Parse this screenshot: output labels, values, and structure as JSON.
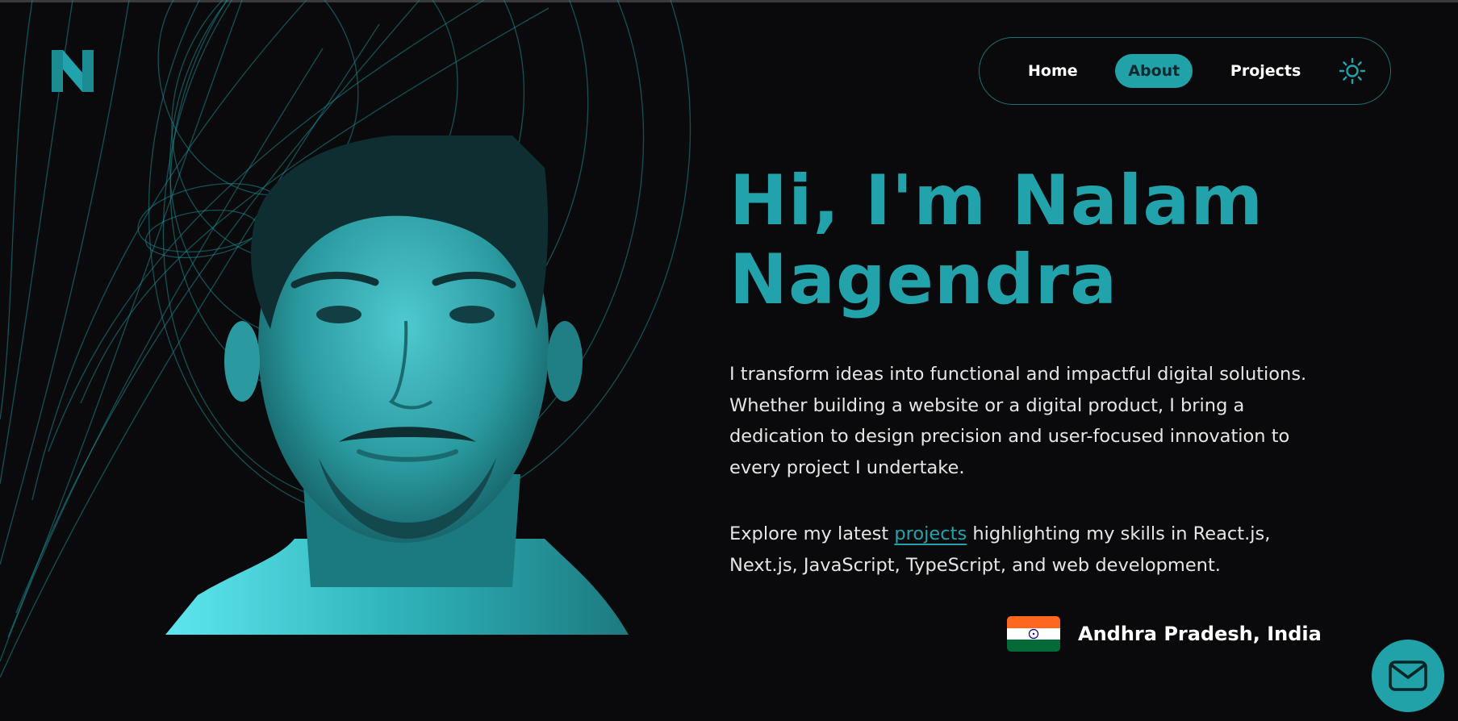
{
  "nav": {
    "items": [
      {
        "label": "Home",
        "active": false
      },
      {
        "label": "About",
        "active": true
      },
      {
        "label": "Projects",
        "active": false
      }
    ],
    "theme_icon": "sun-icon"
  },
  "logo": {
    "icon": "n-logo-icon",
    "letter": "N"
  },
  "hero": {
    "title_line1": "Hi, I'm Nalam",
    "title_line2": "Nagendra",
    "intro": "I transform ideas into functional and impactful digital solutions. Whether building a website or a digital product, I bring a dedication to design precision and user-focused innovation to every project I undertake.",
    "explore_prefix": "Explore my latest ",
    "explore_link": "projects",
    "explore_suffix": " highlighting my skills in React.js, Next.js, JavaScript, TypeScript, and web development."
  },
  "location": {
    "text": "Andhra Pradesh, India",
    "flag_icon": "india-flag-icon"
  },
  "contact": {
    "icon": "mail-icon"
  },
  "colors": {
    "background": "#0a0a0c",
    "accent": "#22a3ab",
    "text": "#e6e6e6"
  }
}
